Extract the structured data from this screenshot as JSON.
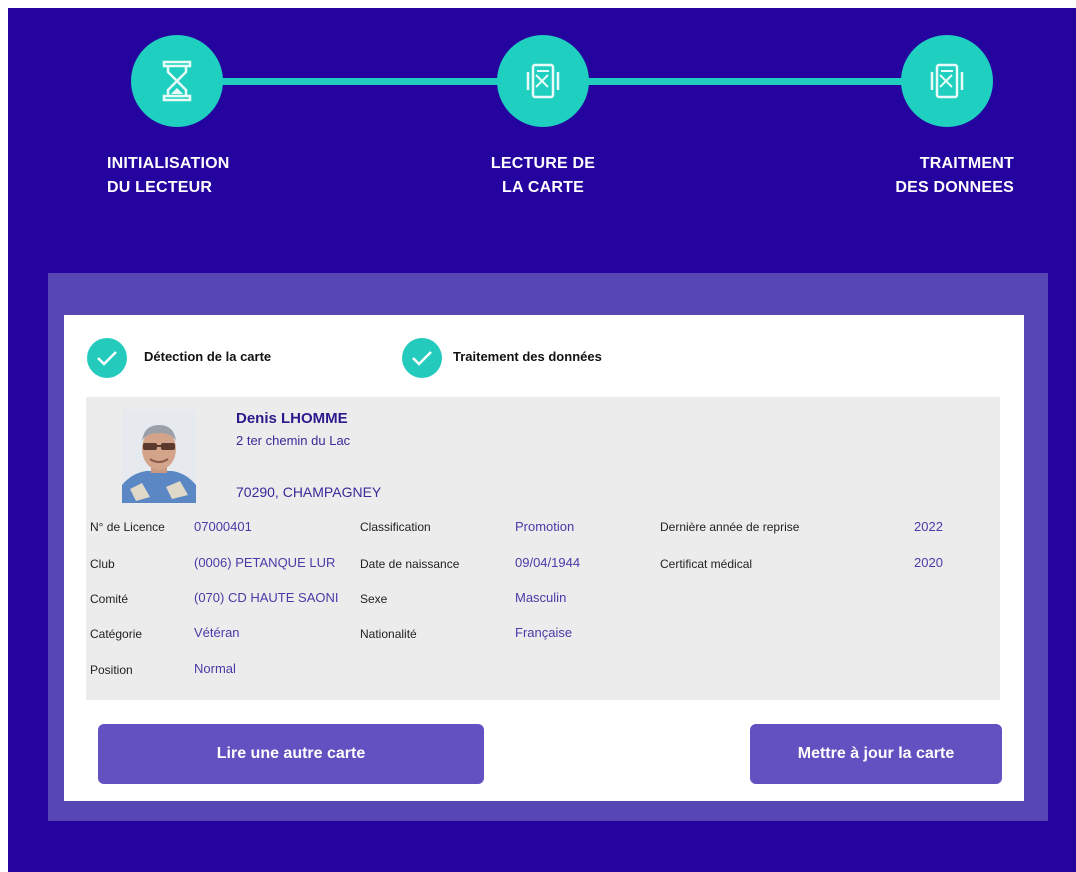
{
  "stepper": {
    "steps": [
      {
        "line1": "INITIALISATION",
        "line2": "DU LECTEUR",
        "icon": "hourglass-icon"
      },
      {
        "line1": "LECTURE DE",
        "line2": "LA CARTE",
        "icon": "card-reader-icon"
      },
      {
        "line1": "TRAITMENT",
        "line2": "DES DONNEES",
        "icon": "card-reader-icon"
      }
    ]
  },
  "status": {
    "detection": "Détection de la carte",
    "processing": "Traitement des données"
  },
  "player": {
    "name": "Denis LHOMME",
    "address_line1": "2 ter chemin du Lac",
    "address_line2": "70290, CHAMPAGNEY"
  },
  "fields": {
    "licence_label": "N° de Licence",
    "licence_value": "07000401",
    "club_label": "Club",
    "club_value": "(0006) PETANQUE LUR",
    "comite_label": "Comité",
    "comite_value": "(070) CD HAUTE SAONI",
    "categorie_label": "Catégorie",
    "categorie_value": "Vétéran",
    "position_label": "Position",
    "position_value": "Normal",
    "classification_label": "Classification",
    "classification_value": "Promotion",
    "naissance_label": "Date de naissance",
    "naissance_value": "09/04/1944",
    "sexe_label": "Sexe",
    "sexe_value": "Masculin",
    "nationalite_label": "Nationalité",
    "nationalite_value": "Française",
    "reprise_label": "Dernière année de reprise",
    "reprise_value": "2022",
    "certificat_label": "Certificat médical",
    "certificat_value": "2020"
  },
  "actions": {
    "read_another": "Lire une autre carte",
    "update_card": "Mettre à jour la carte"
  },
  "colors": {
    "background": "#25039f",
    "accent": "#1fcfbf",
    "panel": "#5647b5",
    "button": "#6350c1"
  }
}
